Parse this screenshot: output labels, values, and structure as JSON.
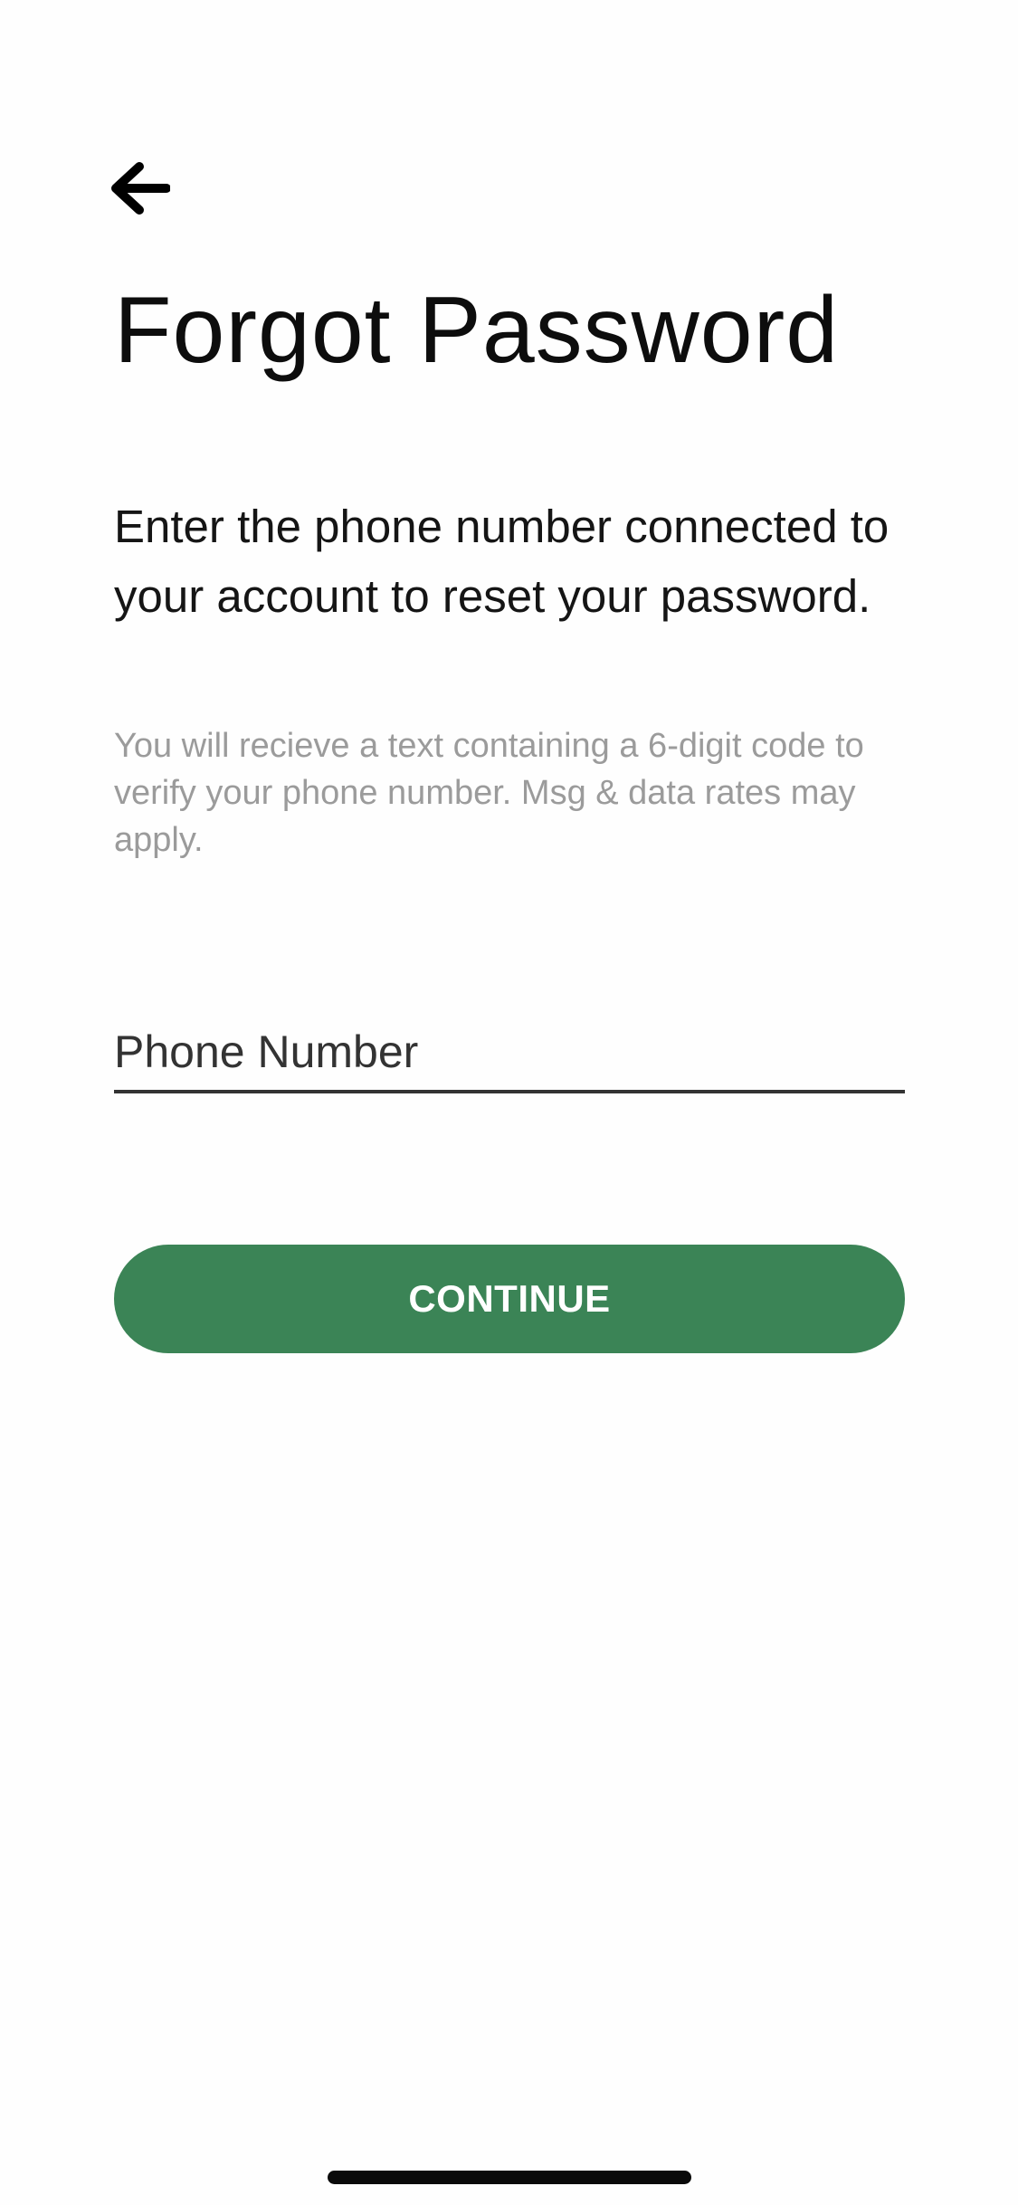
{
  "header": {
    "back_icon": "arrow-left-icon",
    "title": "Forgot Password"
  },
  "content": {
    "instructions": "Enter the phone number connected to your account to reset your password.",
    "disclaimer": "You will recieve a text containing a 6-digit code to verify your phone number. Msg & data rates may apply."
  },
  "form": {
    "phone": {
      "value": "",
      "placeholder": "Phone Number"
    },
    "continue_label": "CONTINUE"
  },
  "colors": {
    "accent": "#3b8456",
    "text": "#111111",
    "muted": "#9b9b9b",
    "background": "#fefefe"
  }
}
